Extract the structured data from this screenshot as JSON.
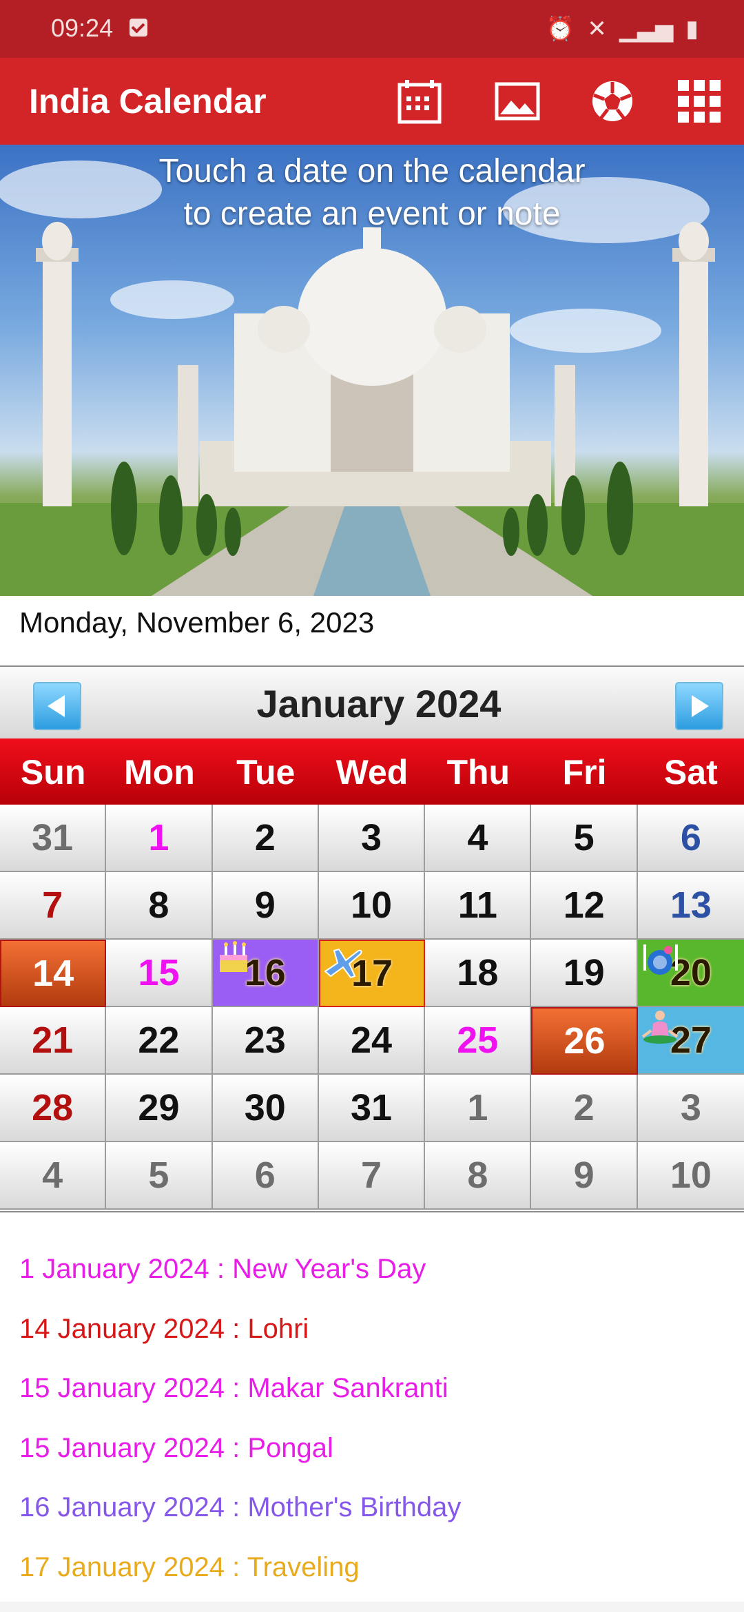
{
  "status": {
    "time": "09:24",
    "indicators": [
      "alarm-icon",
      "vibrate-muted-icon",
      "signal-icon",
      "battery-icon"
    ]
  },
  "app": {
    "title": "India Calendar",
    "actions": [
      "calendar-icon",
      "image-icon",
      "soccer-ball-icon",
      "apps-grid-icon"
    ]
  },
  "hero": {
    "message_line_1": "Touch a date on the calendar",
    "message_line_2": "to create an event or note"
  },
  "today": "Monday, November 6, 2023",
  "calendar": {
    "month_title": "January  2024",
    "weekdays": [
      "Sun",
      "Mon",
      "Tue",
      "Wed",
      "Thu",
      "Fri",
      "Sat"
    ],
    "weeks": [
      [
        "31",
        "1",
        "2",
        "3",
        "4",
        "5",
        "6"
      ],
      [
        "7",
        "8",
        "9",
        "10",
        "11",
        "12",
        "13"
      ],
      [
        "14",
        "15",
        "16",
        "17",
        "18",
        "19",
        "20"
      ],
      [
        "21",
        "22",
        "23",
        "24",
        "25",
        "26",
        "27"
      ],
      [
        "28",
        "29",
        "30",
        "31",
        "1",
        "2",
        "3"
      ],
      [
        "4",
        "5",
        "6",
        "7",
        "8",
        "9",
        "10"
      ]
    ],
    "event_icons": {
      "16": "birthday-cake-icon",
      "17": "airplane-icon",
      "20": "dining-icon",
      "27": "yoga-icon"
    }
  },
  "events": [
    {
      "text": "1 January 2024 : New Year's Day",
      "color": "#e81de8"
    },
    {
      "text": "14 January 2024 : Lohri",
      "color": "#d71616"
    },
    {
      "text": "15 January 2024 : Makar Sankranti",
      "color": "#e81de8"
    },
    {
      "text": "15 January 2024 : Pongal",
      "color": "#e81de8"
    },
    {
      "text": "16 January 2024 : Mother's Birthday",
      "color": "#8658ea"
    },
    {
      "text": "17 January 2024 : Traveling",
      "color": "#e8ab1d"
    }
  ],
  "colors": {
    "app_bar": "#d32428",
    "status_bar": "#b31f24",
    "weekday_header": "#d00a13",
    "holiday_pink": "#ef11ef"
  }
}
